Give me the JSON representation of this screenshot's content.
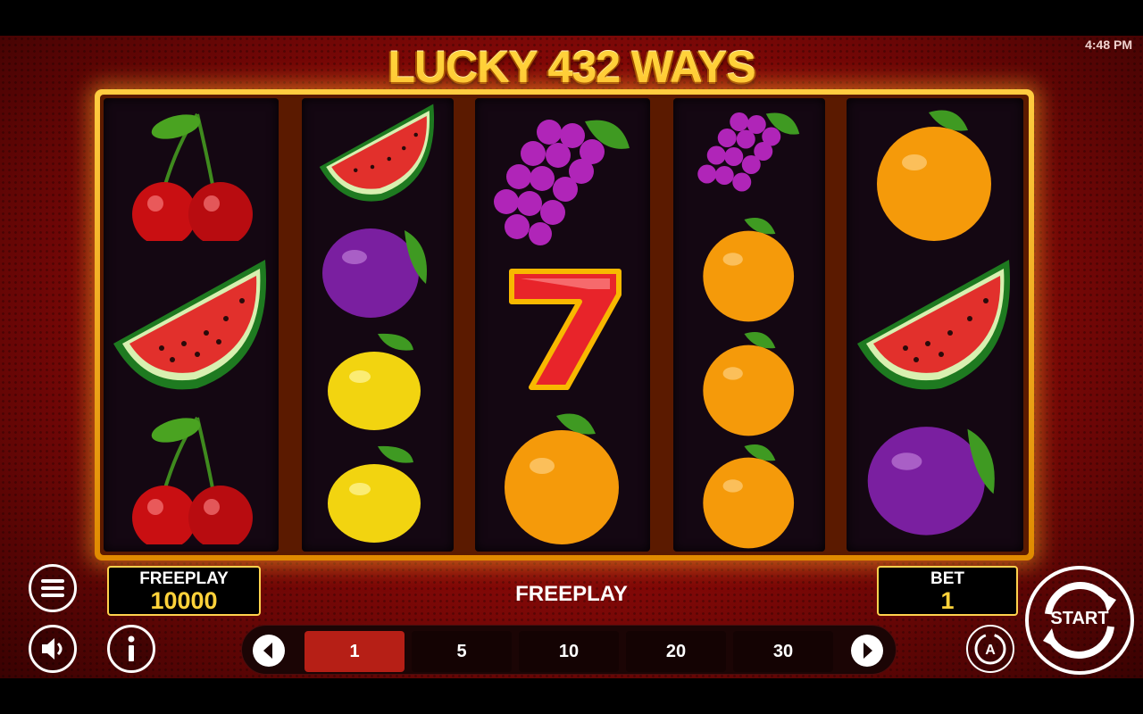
{
  "status_bar": {
    "time": "4:48 PM"
  },
  "game": {
    "title": "LUCKY 432 WAYS"
  },
  "reels": [
    [
      "cherry",
      "watermelon",
      "cherry"
    ],
    [
      "watermelon",
      "plum",
      "lemon",
      "lemon"
    ],
    [
      "grapes",
      "seven",
      "orange"
    ],
    [
      "grapes",
      "orange",
      "orange",
      "orange"
    ],
    [
      "orange",
      "watermelon",
      "plum"
    ]
  ],
  "seven_symbol": {
    "text": "7"
  },
  "balance": {
    "label": "FREEPLAY",
    "value": "10000"
  },
  "bet": {
    "label": "BET",
    "value": "1"
  },
  "center_label": "FREEPLAY",
  "bet_options": [
    "1",
    "5",
    "10",
    "20",
    "30"
  ],
  "selected_bet": "1",
  "start_button": {
    "label": "START"
  },
  "icons": {
    "menu": "menu-icon",
    "sound": "speaker-icon",
    "info": "info-icon",
    "autoplay": "autoplay-icon",
    "prev": "chevron-left-icon",
    "next": "chevron-right-icon"
  },
  "colors": {
    "accent_gold": "#ffd23a",
    "selected_bet": "#b61f16",
    "background_red": "#9b0f0c"
  }
}
